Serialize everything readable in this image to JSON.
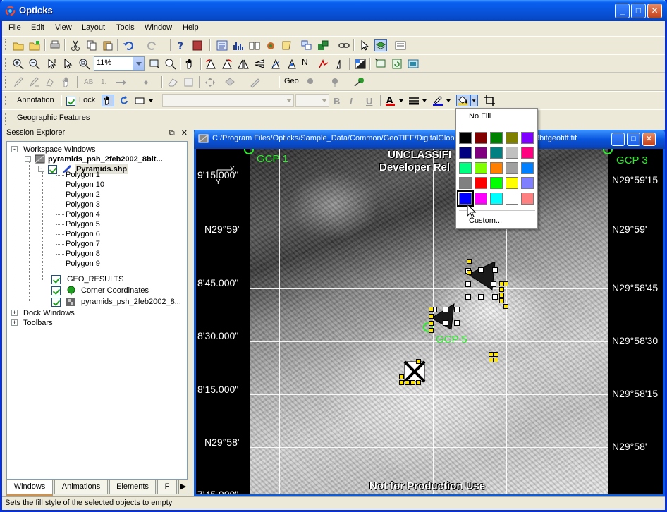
{
  "app": {
    "title": "Opticks"
  },
  "colors": {
    "title_blue": "#0855dd",
    "chrome": "#ece9d8",
    "gcp_green": "#2eea2e"
  },
  "menu": [
    "File",
    "Edit",
    "View",
    "Layout",
    "Tools",
    "Window",
    "Help"
  ],
  "toolbar": {
    "zoom_value": "11%",
    "geo_label": "Geo",
    "annotation_label": "Annotation",
    "lock_label": "Lock",
    "bold": "B",
    "italic": "I",
    "underline": "U",
    "ab_label": "AB",
    "one_label": "1.",
    "n_label": "N",
    "geographic_features": "Geographic Features"
  },
  "session": {
    "title": "Session Explorer",
    "workspace": "Workspace Windows",
    "dataset": "pyramids_psh_2feb2002_8bit...",
    "shapefile": "Pyramids.shp",
    "polygons": [
      "Polygon 1",
      "Polygon 10",
      "Polygon 2",
      "Polygon 3",
      "Polygon 4",
      "Polygon 5",
      "Polygon 6",
      "Polygon 7",
      "Polygon 8",
      "Polygon 9"
    ],
    "geo_results": "GEO_RESULTS",
    "corner_coords": "Corner Coordinates",
    "raster_layer": "pyramids_psh_2feb2002_8...",
    "dock_windows": "Dock Windows",
    "toolbars": "Toolbars",
    "tabs": [
      "Windows",
      "Animations",
      "Elements",
      "F"
    ]
  },
  "child_window": {
    "title_left": "C:/Program Files/Opticks/Sample_Data/Common/GeoTIFF/DigitalGlobe/p",
    "title_right": "8bitgeotiff.tif"
  },
  "map": {
    "overlay_top1": "UNCLASSIFI",
    "overlay_top2": "Developer Rel",
    "overlay_bottom": "Not for Production Use",
    "gcp3": "GCP 3",
    "gcp1": "GCP 1",
    "gcp5": "GCP 5",
    "axis_x": "X",
    "axis_y": "Y",
    "left_labels": [
      "9'15.000\"",
      "N29°59'",
      "8'45.000\"",
      "8'30.000\"",
      "8'15.000\"",
      "N29°58'",
      "7'45.000\""
    ],
    "right_labels": [
      "N29°59'15",
      "N29°59'",
      "N29°58'45",
      "N29°58'30",
      "N29°58'15",
      "N29°58'"
    ]
  },
  "popup": {
    "no_fill": "No Fill",
    "custom": "Custom...",
    "swatches": [
      [
        "#000000",
        "#800000",
        "#008000",
        "#808000",
        "#8000ff"
      ],
      [
        "#000080",
        "#800080",
        "#008080",
        "#c0c0c0",
        "#ff0080"
      ],
      [
        "#00ff80",
        "#80ff00",
        "#ff8000",
        "#a0a0a0",
        "#0080ff"
      ],
      [
        "#808080",
        "#ff0000",
        "#00ff00",
        "#ffff00",
        "#8080ff"
      ],
      [
        "#0000ff",
        "#ff00ff",
        "#00ffff",
        "#ffffff",
        "#ff8080"
      ]
    ]
  },
  "status": {
    "text": "Sets the fill style of the selected objects to empty"
  }
}
